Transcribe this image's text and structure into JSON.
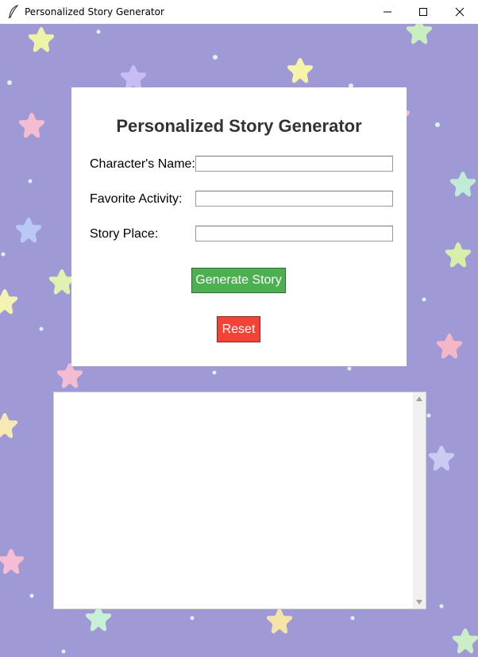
{
  "window": {
    "title": "Personalized Story Generator",
    "icon": "feather-icon"
  },
  "form": {
    "heading": "Personalized Story Generator",
    "fields": [
      {
        "label": "Character's Name:",
        "value": ""
      },
      {
        "label": "Favorite Activity:",
        "value": ""
      },
      {
        "label": "Story Place:",
        "value": ""
      }
    ],
    "generate_label": "Generate Story",
    "reset_label": "Reset"
  },
  "story_output": {
    "text": ""
  },
  "colors": {
    "background": "#9f9ad6",
    "generate_button": "#4caf50",
    "reset_button": "#f44336",
    "heading_text": "#333333"
  }
}
